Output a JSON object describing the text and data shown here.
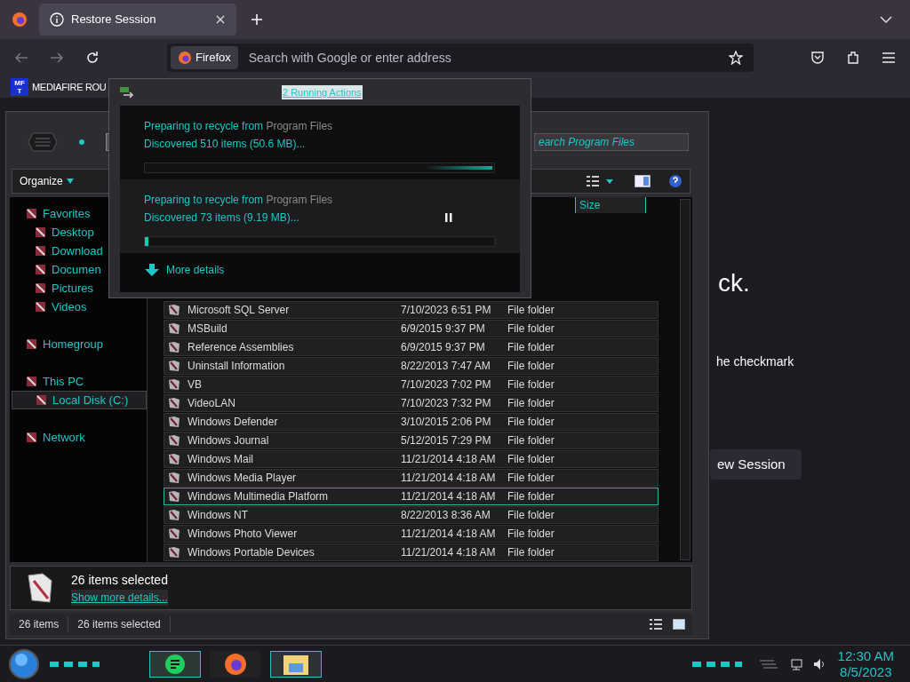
{
  "browser": {
    "tabs": [
      {
        "title": "Restore Session",
        "selected": true
      }
    ],
    "identity_chip": "Firefox",
    "address_placeholder": "Search with Google or enter address",
    "bookmarks": [
      {
        "icon_lines": [
          "MF",
          "T"
        ],
        "label": "MEDIAFIRE ROU"
      }
    ],
    "page": {
      "heading_tail": "ck.",
      "text_tail": "he checkmark",
      "button_tail": "ew Session"
    }
  },
  "explorer": {
    "search_placeholder": "earch Program Files",
    "toolbar": {
      "organize": "Organize"
    },
    "columns": [
      {
        "label": "Size"
      }
    ],
    "sidebar": [
      {
        "label": "Favorites",
        "group": true,
        "selected": false
      },
      {
        "label": "Desktop",
        "group": false,
        "selected": false
      },
      {
        "label": "Download",
        "group": false,
        "selected": false
      },
      {
        "label": "Documen",
        "group": false,
        "selected": false
      },
      {
        "label": "Pictures",
        "group": false,
        "selected": false
      },
      {
        "label": "Videos",
        "group": false,
        "selected": false
      },
      {
        "label": "Homegroup",
        "group": true,
        "selected": false,
        "gap": true
      },
      {
        "label": "This PC",
        "group": true,
        "selected": false,
        "gap": true
      },
      {
        "label": "Local Disk (C:)",
        "group": false,
        "selected": true
      },
      {
        "label": "Network",
        "group": true,
        "selected": false,
        "gap": true
      }
    ],
    "rows": [
      {
        "name": "Microsoft SQL Server",
        "date": "7/10/2023 6:51 PM",
        "type": "File folder",
        "focused": false
      },
      {
        "name": "MSBuild",
        "date": "6/9/2015 9:37 PM",
        "type": "File folder",
        "focused": false
      },
      {
        "name": "Reference Assemblies",
        "date": "6/9/2015 9:37 PM",
        "type": "File folder",
        "focused": false
      },
      {
        "name": "Uninstall Information",
        "date": "8/22/2013 7:47 AM",
        "type": "File folder",
        "focused": false
      },
      {
        "name": "VB",
        "date": "7/10/2023 7:02 PM",
        "type": "File folder",
        "focused": false
      },
      {
        "name": "VideoLAN",
        "date": "7/10/2023 7:32 PM",
        "type": "File folder",
        "focused": false
      },
      {
        "name": "Windows Defender",
        "date": "3/10/2015 2:06 PM",
        "type": "File folder",
        "focused": false
      },
      {
        "name": "Windows Journal",
        "date": "5/12/2015 7:29 PM",
        "type": "File folder",
        "focused": false
      },
      {
        "name": "Windows Mail",
        "date": "11/21/2014 4:18 AM",
        "type": "File folder",
        "focused": false
      },
      {
        "name": "Windows Media Player",
        "date": "11/21/2014 4:18 AM",
        "type": "File folder",
        "focused": false
      },
      {
        "name": "Windows Multimedia Platform",
        "date": "11/21/2014 4:18 AM",
        "type": "File folder",
        "focused": true
      },
      {
        "name": "Windows NT",
        "date": "8/22/2013 8:36 AM",
        "type": "File folder",
        "focused": false
      },
      {
        "name": "Windows Photo Viewer",
        "date": "11/21/2014 4:18 AM",
        "type": "File folder",
        "focused": false
      },
      {
        "name": "Windows Portable Devices",
        "date": "11/21/2014 4:18 AM",
        "type": "File folder",
        "focused": false
      }
    ],
    "details": {
      "title": "26 items selected",
      "link": "Show more details..."
    },
    "status_bar": {
      "count": "26 items",
      "selected": "26 items selected"
    }
  },
  "dialog": {
    "title": "2 Running Actions",
    "operations": [
      {
        "prefix": "Preparing to recycle from",
        "source": "Program Files",
        "progress": "Discovered 510 items (50.6 MB)...",
        "kind": "indeterminate",
        "highlighted": false
      },
      {
        "prefix": "Preparing to recycle from",
        "source": "Program Files",
        "progress": "Discovered 73 items (9.19 MB)...",
        "kind": "determinate",
        "level": 0.01,
        "highlighted": true
      }
    ],
    "more_details": "More details"
  },
  "taskbar": {
    "time": "12:30 AM",
    "date": "8/5/2023"
  }
}
